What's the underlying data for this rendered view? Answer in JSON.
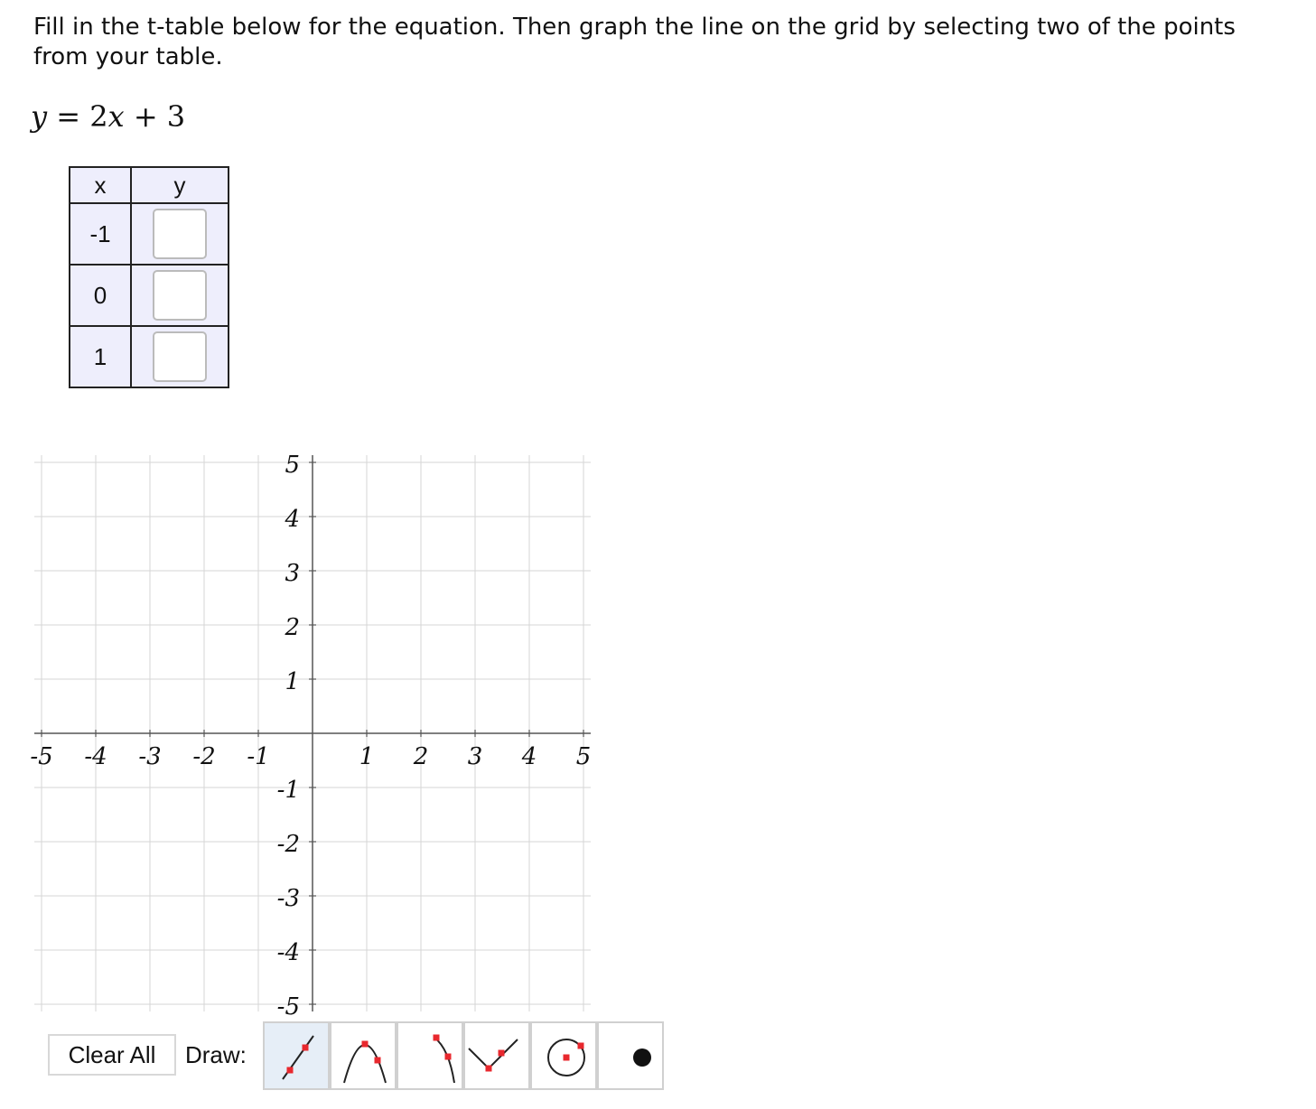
{
  "instructions": "Fill in the t-table below for the equation. Then graph the line on the grid by selecting two of the points from your table.",
  "equation": {
    "lhs": "y",
    "eq": "=",
    "coef": "2",
    "var": "x",
    "op": "+",
    "const": "3"
  },
  "ttable": {
    "headers": [
      "x",
      "y"
    ],
    "rows": [
      {
        "x": "-1",
        "y": ""
      },
      {
        "x": "0",
        "y": ""
      },
      {
        "x": "1",
        "y": ""
      }
    ]
  },
  "graph": {
    "x_range": [
      -5,
      5
    ],
    "y_range": [
      -5,
      5
    ],
    "x_tick_labels": [
      "-5",
      "-4",
      "-3",
      "-2",
      "-1",
      "1",
      "2",
      "3",
      "4",
      "5"
    ],
    "y_tick_labels": [
      "5",
      "4",
      "3",
      "2",
      "1",
      "-1",
      "-2",
      "-3",
      "-4",
      "-5"
    ],
    "grid_color": "#d6d6d6",
    "axis_color": "#555555"
  },
  "toolbar": {
    "clear_label": "Clear All",
    "draw_label": "Draw:",
    "tools": [
      {
        "icon": "line-tool-icon",
        "selected": true
      },
      {
        "icon": "parabola-tool-icon",
        "selected": false
      },
      {
        "icon": "curve-tool-icon",
        "selected": false
      },
      {
        "icon": "absolute-value-tool-icon",
        "selected": false
      },
      {
        "icon": "circle-tool-icon",
        "selected": false
      },
      {
        "icon": "point-tool-icon",
        "selected": false
      }
    ],
    "accent_color": "#e8282e"
  }
}
